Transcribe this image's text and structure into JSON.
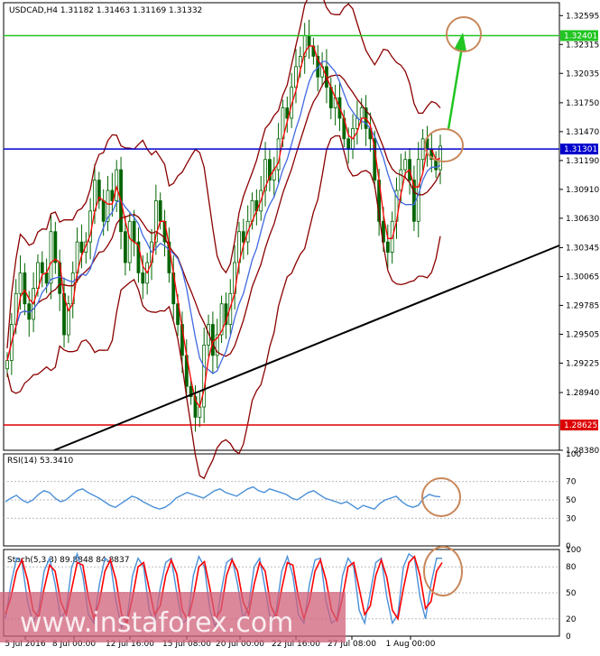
{
  "chart_data": [
    {
      "type": "line",
      "title": "USDCAD,H4  1.31182 1.31463 1.31169 1.31332",
      "ylim": [
        1.2838,
        1.3272
      ],
      "y_ticks": [
        "1.32595",
        "1.32315",
        "1.32035",
        "1.31750",
        "1.31470",
        "1.31190",
        "1.30910",
        "1.30630",
        "1.30345",
        "1.30065",
        "1.29785",
        "1.29505",
        "1.29225",
        "1.28940",
        "1.28380"
      ],
      "x_ticks": [
        "5 Jul 2016",
        "8 Jul 00:00",
        "12 Jul 16:00",
        "15 Jul 08:00",
        "20 Jul 00:00",
        "22 Jul 16:00",
        "27 Jul 08:00",
        "1 Aug 00:00"
      ],
      "horizontal_levels": [
        {
          "value": 1.32401,
          "label": "1.32401",
          "color": "#22c522"
        },
        {
          "value": 1.31301,
          "label": "1.31301",
          "color": "#0000cc"
        },
        {
          "value": 1.28625,
          "label": "1.28625",
          "color": "#dd0000"
        }
      ],
      "candles_count": 100,
      "close_series": [
        1.2925,
        1.296,
        1.299,
        1.301,
        1.298,
        1.2965,
        1.2995,
        1.302,
        1.301,
        1.3,
        1.305,
        1.302,
        1.299,
        1.295,
        1.298,
        1.301,
        1.304,
        1.303,
        1.304,
        1.307,
        1.31,
        1.308,
        1.306,
        1.309,
        1.308,
        1.311,
        1.305,
        1.302,
        1.306,
        1.304,
        1.301,
        1.3,
        1.302,
        1.304,
        1.308,
        1.306,
        1.304,
        1.301,
        1.298,
        1.296,
        1.293,
        1.29,
        1.289,
        1.287,
        1.288,
        1.294,
        1.296,
        1.293,
        1.295,
        1.298,
        1.296,
        1.299,
        1.302,
        1.305,
        1.304,
        1.306,
        1.308,
        1.307,
        1.309,
        1.312,
        1.31,
        1.311,
        1.314,
        1.317,
        1.316,
        1.319,
        1.321,
        1.322,
        1.324,
        1.323,
        1.322,
        1.32,
        1.321,
        1.319,
        1.317,
        1.318,
        1.316,
        1.314,
        1.313,
        1.315,
        1.316,
        1.317,
        1.315,
        1.314,
        1.31,
        1.306,
        1.304,
        1.303,
        1.306,
        1.309,
        1.311,
        1.312,
        1.31,
        1.306,
        1.312,
        1.314,
        1.313,
        1.312,
        1.311,
        1.3133
      ],
      "lines": [
        {
          "name": "trendline",
          "color": "#000000",
          "points": [
            [
              "7 Jul",
              1.2838
            ],
            [
              "3 Aug",
              1.3034
            ]
          ]
        },
        {
          "name": "arrow",
          "color": "#22c522",
          "points": [
            [
              "1 Aug 04:00",
              1.3145
            ],
            [
              "1 Aug 16:00",
              1.3237
            ]
          ]
        }
      ],
      "ellipses": [
        "upper target ~1.3240",
        "current price ~1.3130"
      ]
    },
    {
      "type": "line",
      "title": "RSI(14) 53.3410",
      "ylim": [
        0,
        100
      ],
      "y_ticks": [
        "100",
        "70",
        "50",
        "30",
        "0"
      ],
      "series": [
        {
          "name": "RSI(14)",
          "values": [
            48,
            52,
            55,
            50,
            47,
            50,
            56,
            60,
            58,
            52,
            48,
            50,
            55,
            60,
            62,
            58,
            55,
            52,
            48,
            44,
            42,
            46,
            50,
            54,
            52,
            48,
            45,
            42,
            40,
            42,
            46,
            52,
            55,
            58,
            56,
            54,
            52,
            56,
            60,
            62,
            58,
            56,
            54,
            58,
            62,
            64,
            60,
            58,
            62,
            60,
            58,
            56,
            52,
            50,
            54,
            58,
            60,
            56,
            52,
            50,
            48,
            46,
            48,
            44,
            40,
            44,
            42,
            40,
            46,
            50,
            52,
            54,
            48,
            44,
            42,
            44,
            52,
            56,
            54,
            53.34
          ]
        }
      ]
    },
    {
      "type": "line",
      "title": "Stoch(5,3,3) 89.8848 84.8837",
      "ylim": [
        0,
        100
      ],
      "y_ticks": [
        "100",
        "80",
        "50",
        "20",
        "0"
      ],
      "series": [
        {
          "name": "main",
          "values": [
            20,
            60,
            90,
            85,
            40,
            15,
            30,
            75,
            90,
            60,
            20,
            30,
            80,
            95,
            70,
            25,
            15,
            60,
            90,
            85,
            40,
            10,
            20,
            70,
            90,
            80,
            30,
            15,
            55,
            85,
            90,
            50,
            15,
            20,
            70,
            92,
            80,
            30,
            10,
            50,
            85,
            90,
            60,
            20,
            35,
            80,
            90,
            55,
            15,
            30,
            75,
            92,
            70,
            25,
            15,
            60,
            88,
            90,
            40,
            15,
            20,
            70,
            90,
            80,
            30,
            15,
            50,
            85,
            90,
            45,
            15,
            25,
            80,
            95,
            90,
            45,
            20,
            60,
            90,
            89.88
          ]
        },
        {
          "name": "signal",
          "values": [
            25,
            45,
            75,
            88,
            65,
            30,
            22,
            55,
            82,
            75,
            40,
            25,
            55,
            85,
            82,
            45,
            20,
            40,
            75,
            88,
            65,
            25,
            15,
            45,
            80,
            85,
            55,
            25,
            35,
            70,
            88,
            72,
            30,
            18,
            45,
            80,
            86,
            55,
            20,
            30,
            70,
            88,
            75,
            40,
            25,
            60,
            85,
            75,
            35,
            22,
            55,
            85,
            82,
            45,
            20,
            40,
            75,
            88,
            65,
            30,
            18,
            45,
            80,
            85,
            55,
            25,
            35,
            70,
            88,
            68,
            30,
            20,
            55,
            85,
            92,
            70,
            32,
            40,
            75,
            84.88
          ]
        }
      ]
    }
  ],
  "colors": {
    "candle": "#006400",
    "bollinger": "#8b0000",
    "ma_fast": "#ff0000",
    "ma_slow": "#4169e1",
    "rsi_line": "#4a90d9",
    "stoch_main": "#4a90d9",
    "stoch_signal": "#ff0000",
    "annotation_circle": "#c8875a"
  },
  "watermark": "www.instaforex.com"
}
